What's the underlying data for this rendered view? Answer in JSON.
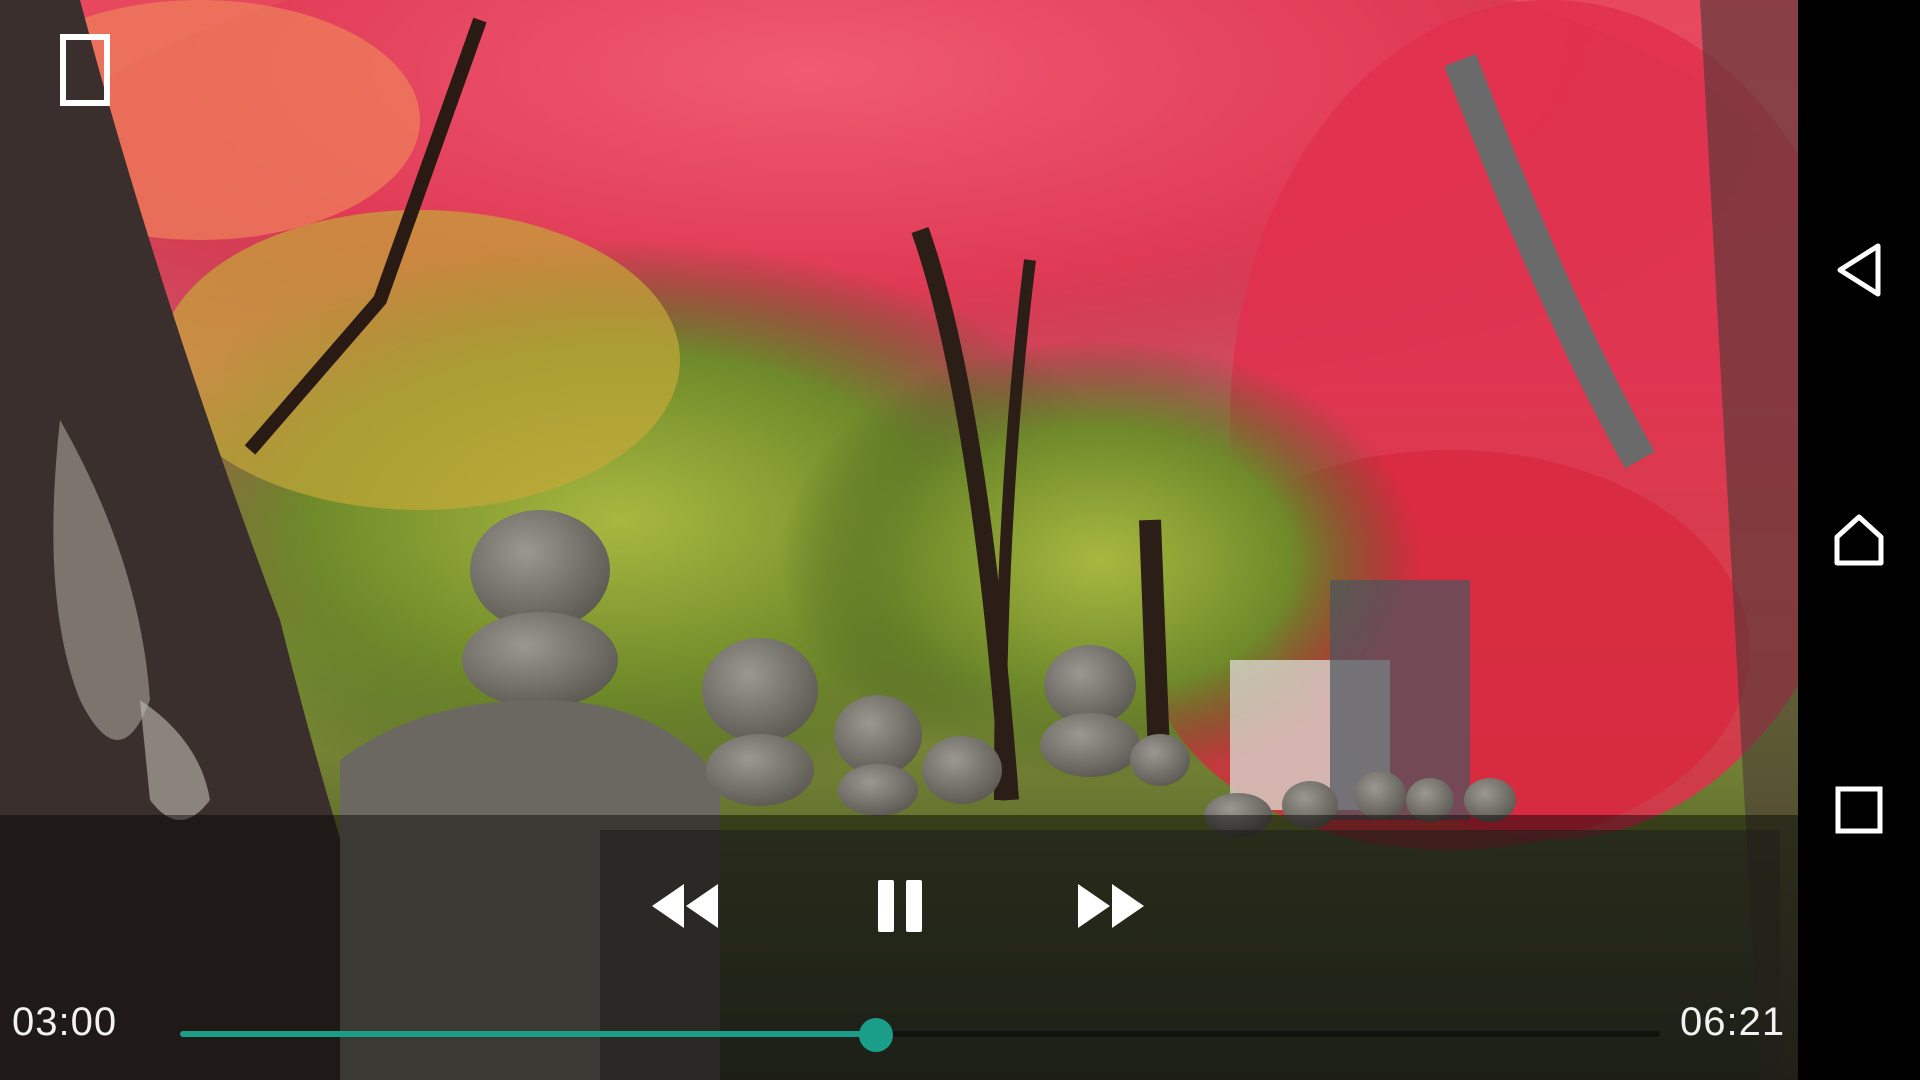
{
  "player": {
    "current_time": "03:00",
    "total_time": "06:21",
    "progress": 0.47,
    "accent_color": "#1a9e8a",
    "state": "playing"
  },
  "controls": {
    "rewind_icon": "rewind-icon",
    "pause_icon": "pause-icon",
    "fast_forward_icon": "fast-forward-icon"
  },
  "navbar": {
    "back_icon": "back-triangle-icon",
    "home_icon": "home-icon",
    "recents_icon": "recents-square-icon"
  }
}
